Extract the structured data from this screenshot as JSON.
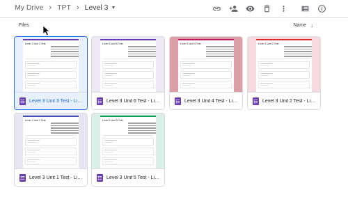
{
  "breadcrumb": {
    "items": [
      "My Drive",
      "TPT",
      "Level 3"
    ]
  },
  "toolbar": {
    "icons": [
      "link-icon",
      "add-person-icon",
      "preview-icon",
      "trash-icon",
      "more-vert-icon",
      "view-toggle-icon",
      "info-icon"
    ]
  },
  "files_label": "Files",
  "sort": {
    "label": "Name",
    "direction_icon": "arrow-down-icon"
  },
  "files": [
    {
      "name": "Level 3 Unit 3 Test - Liste...",
      "thumb_title": "Level 3 Unit 3 Test",
      "selected": true,
      "bg": "#e8f0fe",
      "accent": "#673ab7"
    },
    {
      "name": "Level 3 Unit 6 Test - Liste...",
      "thumb_title": "Level 3 Unit 6 Test",
      "selected": false,
      "bg": "#ede7f6",
      "accent": "#673ab7"
    },
    {
      "name": "Level 3 Unit 4 Test - Liste...",
      "thumb_title": "Level 3 Unit 4 Test",
      "selected": false,
      "bg": "#db9ea5",
      "accent": "#c2185b"
    },
    {
      "name": "Level 3 Unit 2 Test - Liste...",
      "thumb_title": "Level 3 Unit 2 Test",
      "selected": false,
      "bg": "#f7dadd",
      "accent": "#d32f2f"
    },
    {
      "name": "Level 3 Unit 1 Test - Liste...",
      "thumb_title": "Level 3 Unit 1 Test",
      "selected": false,
      "bg": "#e6e6f2",
      "accent": "#3f51b5"
    },
    {
      "name": "Level 3 Unit 5 Test - Liste...",
      "thumb_title": "Level 3 Unit 5 Test",
      "selected": false,
      "bg": "#d9efe7",
      "accent": "#0f9d58"
    }
  ],
  "colors": {
    "selection": "#1a73e8",
    "forms_icon": "#673ab7"
  }
}
